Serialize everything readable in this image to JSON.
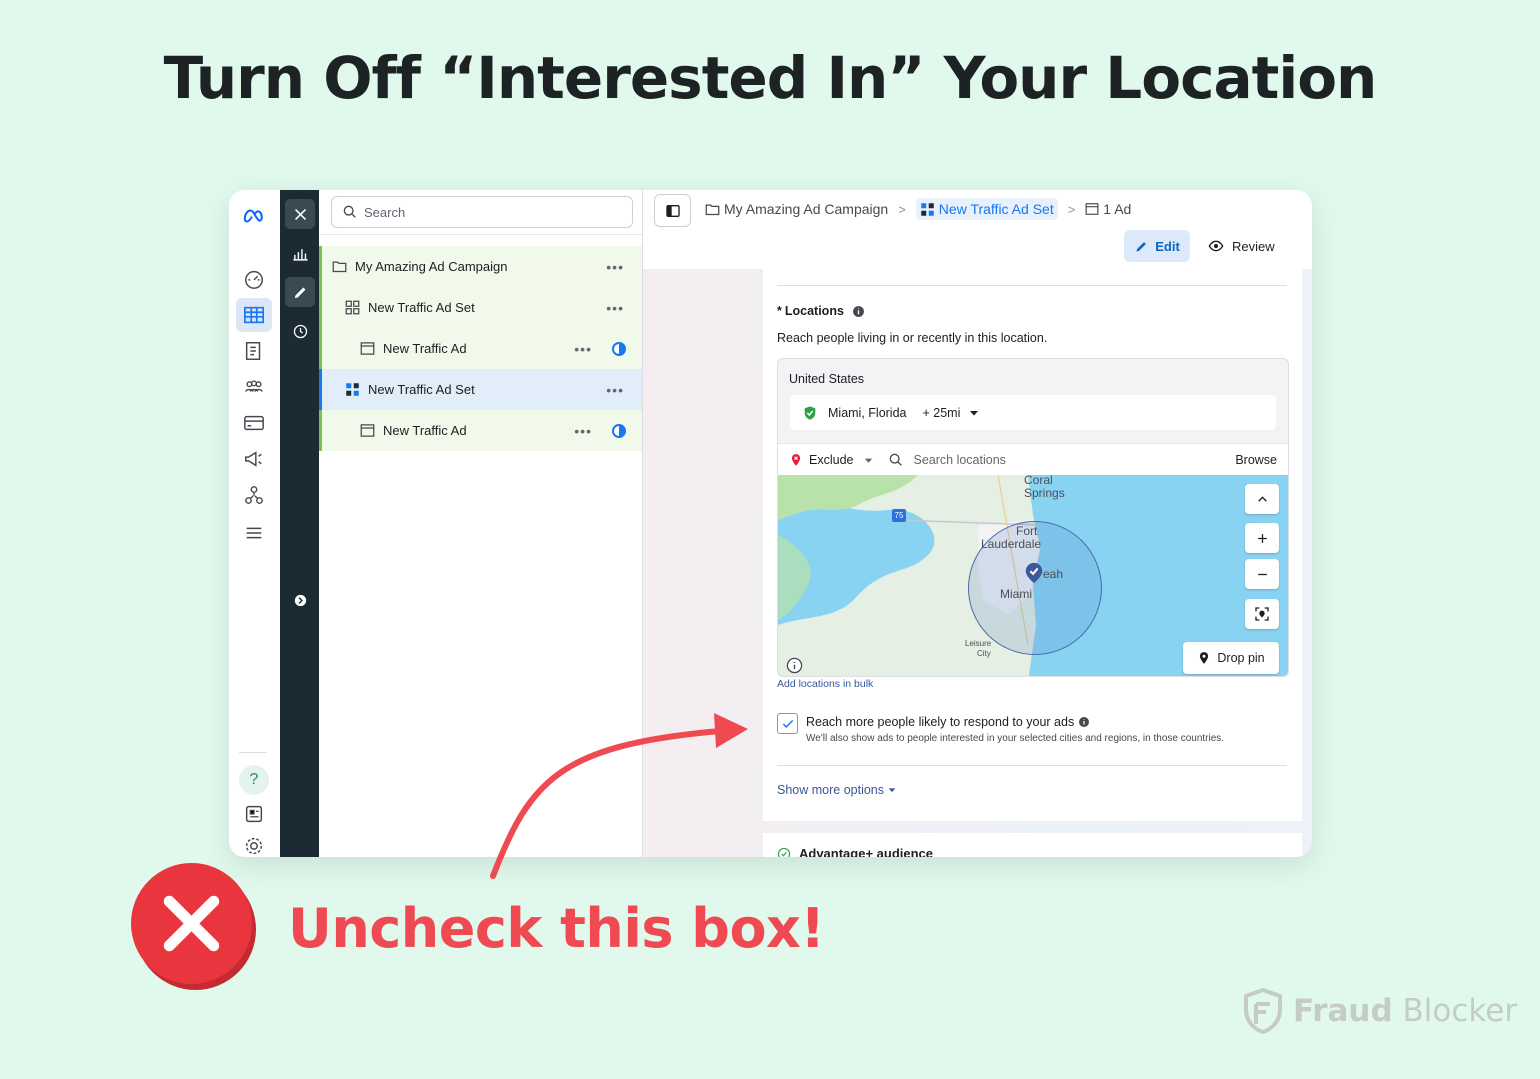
{
  "headline": "Turn Off “Interested In” Your Location",
  "annotation": "Uncheck this box!",
  "brand": {
    "word1": "Fraud",
    "word2": "Blocker"
  },
  "tree": {
    "search_placeholder": "Search",
    "rows": [
      {
        "label": "My Amazing Ad Campaign",
        "kind": "campaign"
      },
      {
        "label": "New Traffic Ad Set",
        "kind": "adset"
      },
      {
        "label": "New Traffic Ad",
        "kind": "ad"
      },
      {
        "label": "New Traffic Ad Set",
        "kind": "adset",
        "selected": true
      },
      {
        "label": "New Traffic Ad",
        "kind": "ad"
      }
    ],
    "more": "•••"
  },
  "breadcrumb": {
    "campaign": "My Amazing Ad Campaign",
    "adset": "New Traffic Ad Set",
    "ad": "1 Ad",
    "sep": ">"
  },
  "toolbar": {
    "edit": "Edit",
    "review": "Review"
  },
  "locations": {
    "title": "Locations",
    "required_mark": "*",
    "subtitle": "Reach people living in or recently in this location.",
    "country": "United States",
    "selected": "Miami, Florida",
    "radius": "+ 25mi",
    "exclude": "Exclude",
    "search_placeholder": "Search locations",
    "browse": "Browse",
    "drop_pin": "Drop pin",
    "add_bulk": "Add locations in bulk",
    "map_labels": {
      "coral": "Coral",
      "springs": "Springs",
      "fort": "Fort",
      "lauderdale": "Lauderdale",
      "hialeah": "eah",
      "miami": "Miami",
      "leisure": "Leisure",
      "city": "City",
      "highway": "75"
    }
  },
  "reach_more": {
    "checked": true,
    "label": "Reach more people likely to respond to your ads",
    "desc": "We'll also show ads to people interested in your selected cities and regions, in those countries."
  },
  "show_more": "Show more options",
  "next_section": "Advantage+ audience",
  "colors": {
    "background": "#e0f9ec",
    "accent_red": "#ef4a51",
    "meta_blue": "#1877f2",
    "dark_rail": "#1c2b33"
  }
}
